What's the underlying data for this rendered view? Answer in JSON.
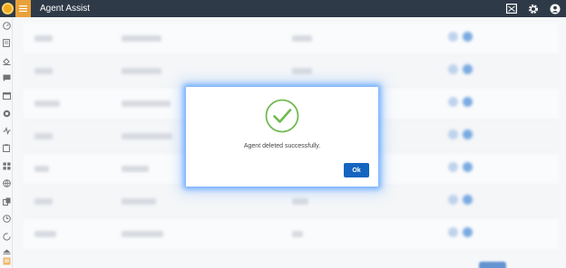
{
  "header": {
    "title": "Agent Assist",
    "icons": [
      "app-logo-icon",
      "hamburger-menu-icon",
      "screen-icon",
      "gear-icon",
      "user-account-icon"
    ],
    "accent_color": "#e8a13a",
    "bar_color": "#2f3a48"
  },
  "sidebar": {
    "icons": [
      "dashboard-icon",
      "document-icon",
      "paint-bucket-icon",
      "chat-icon",
      "window-icon",
      "circle-icon",
      "activity-icon",
      "clipboard-icon",
      "grid-icon",
      "globe-icon",
      "copy-icon",
      "clock-icon",
      "refresh-icon",
      "eject-icon",
      "note-icon"
    ]
  },
  "dialog": {
    "message": "Agent deleted successfully.",
    "ok_label": "Ok",
    "icon": "success-check-icon",
    "check_color": "#6fba4f",
    "button_color": "#1565c0"
  }
}
